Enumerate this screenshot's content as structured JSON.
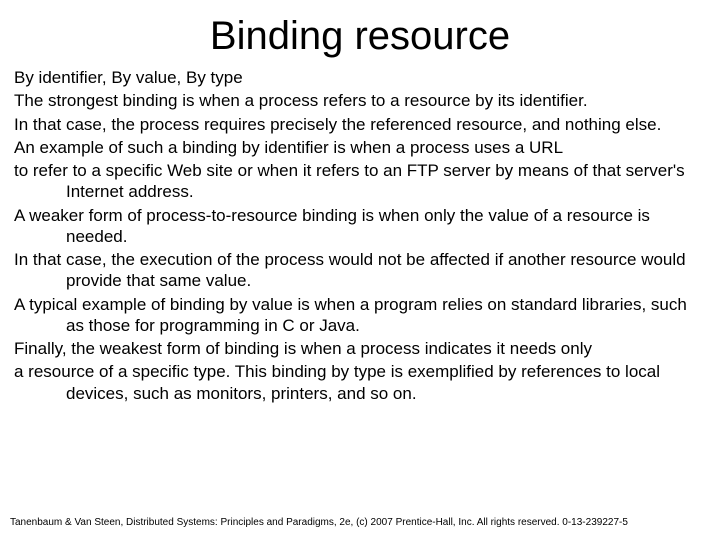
{
  "title": "Binding resource",
  "lines": {
    "l1": "By identifier, By value, By type",
    "l2": "The strongest binding is when a process refers to a resource by its identifier.",
    "l3": "In that case, the process requires precisely the referenced resource, and nothing else.",
    "l4": " An example of such a binding by identifier is when a process uses a URL",
    "l5": "to refer to a specific Web site or when it refers to an FTP server by means of that server's Internet address.",
    "l6": " A weaker form of process-to-resource binding is when only the value of a resource is needed.",
    "l7": "In that case, the execution of the process would not be affected if another resource would provide that same value.",
    "l8": " A typical example of binding by value is when a program relies on standard libraries, such as those for programming in C or Java.",
    "l9": " Finally, the weakest form of binding is when a process indicates it needs only",
    "l10": "a resource of a specific type. This binding by type is exemplified by references to local devices, such as monitors, printers, and so on."
  },
  "footer": "Tanenbaum & Van Steen, Distributed Systems: Principles and Paradigms, 2e, (c) 2007 Prentice-Hall, Inc. All rights reserved. 0-13-239227-5"
}
